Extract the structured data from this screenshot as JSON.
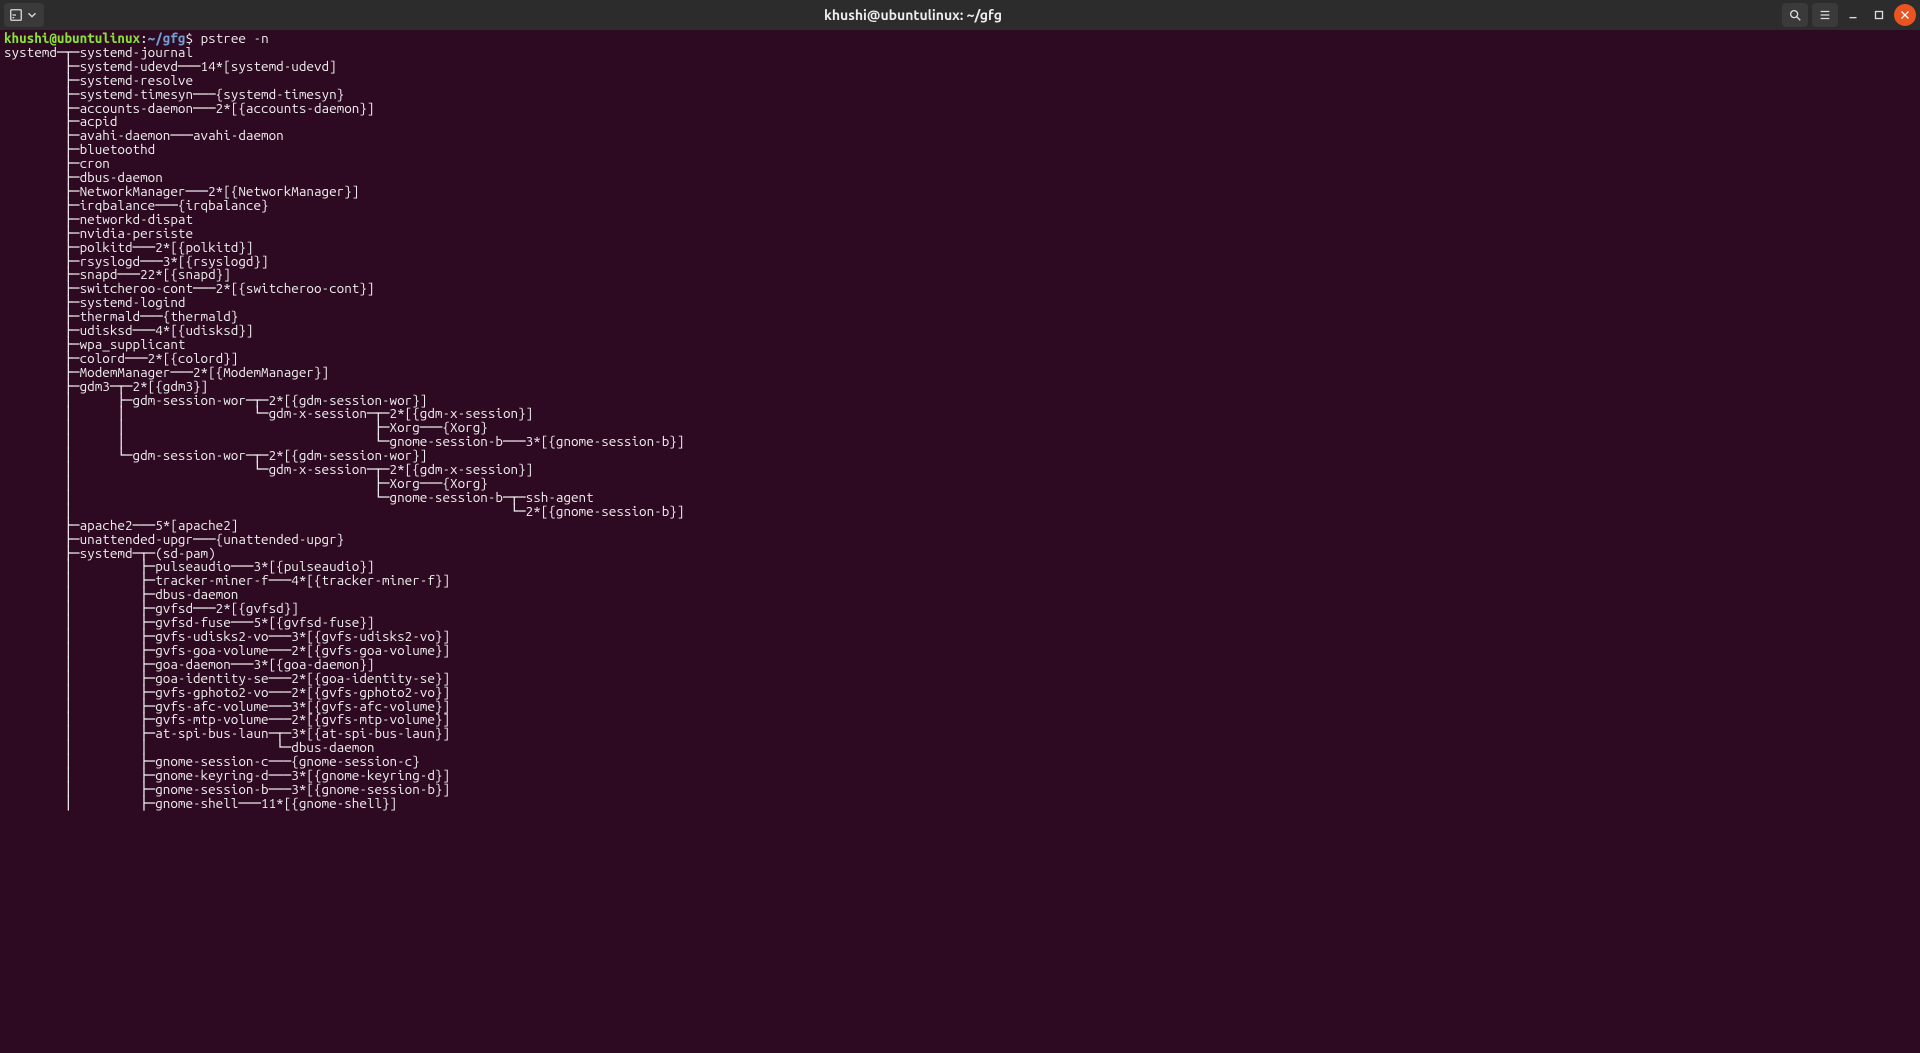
{
  "window": {
    "title": "khushi@ubuntulinux: ~/gfg"
  },
  "prompt": {
    "user_host": "khushi@ubuntulinux",
    "colon": ":",
    "path": "~/gfg",
    "symbol": "$",
    "command": "pstree -n"
  },
  "tree": "systemd─┬─systemd-journal\n        ├─systemd-udevd───14*[systemd-udevd]\n        ├─systemd-resolve\n        ├─systemd-timesyn───{systemd-timesyn}\n        ├─accounts-daemon───2*[{accounts-daemon}]\n        ├─acpid\n        ├─avahi-daemon───avahi-daemon\n        ├─bluetoothd\n        ├─cron\n        ├─dbus-daemon\n        ├─NetworkManager───2*[{NetworkManager}]\n        ├─irqbalance───{irqbalance}\n        ├─networkd-dispat\n        ├─nvidia-persiste\n        ├─polkitd───2*[{polkitd}]\n        ├─rsyslogd───3*[{rsyslogd}]\n        ├─snapd───22*[{snapd}]\n        ├─switcheroo-cont───2*[{switcheroo-cont}]\n        ├─systemd-logind\n        ├─thermald───{thermald}\n        ├─udisksd───4*[{udisksd}]\n        ├─wpa_supplicant\n        ├─colord───2*[{colord}]\n        ├─ModemManager───2*[{ModemManager}]\n        ├─gdm3─┬─2*[{gdm3}]\n        │      ├─gdm-session-wor─┬─2*[{gdm-session-wor}]\n        │      │                 └─gdm-x-session─┬─2*[{gdm-x-session}]\n        │      │                                 ├─Xorg───{Xorg}\n        │      │                                 └─gnome-session-b───3*[{gnome-session-b}]\n        │      └─gdm-session-wor─┬─2*[{gdm-session-wor}]\n        │                        └─gdm-x-session─┬─2*[{gdm-x-session}]\n        │                                        ├─Xorg───{Xorg}\n        │                                        └─gnome-session-b─┬─ssh-agent\n        │                                                          └─2*[{gnome-session-b}]\n        ├─apache2───5*[apache2]\n        ├─unattended-upgr───{unattended-upgr}\n        ├─systemd─┬─(sd-pam)\n        │         ├─pulseaudio───3*[{pulseaudio}]\n        │         ├─tracker-miner-f───4*[{tracker-miner-f}]\n        │         ├─dbus-daemon\n        │         ├─gvfsd───2*[{gvfsd}]\n        │         ├─gvfsd-fuse───5*[{gvfsd-fuse}]\n        │         ├─gvfs-udisks2-vo───3*[{gvfs-udisks2-vo}]\n        │         ├─gvfs-goa-volume───2*[{gvfs-goa-volume}]\n        │         ├─goa-daemon───3*[{goa-daemon}]\n        │         ├─goa-identity-se───2*[{goa-identity-se}]\n        │         ├─gvfs-gphoto2-vo───2*[{gvfs-gphoto2-vo}]\n        │         ├─gvfs-afc-volume───3*[{gvfs-afc-volume}]\n        │         ├─gvfs-mtp-volume───2*[{gvfs-mtp-volume}]\n        │         ├─at-spi-bus-laun─┬─3*[{at-spi-bus-laun}]\n        │         │                 └─dbus-daemon\n        │         ├─gnome-session-c───{gnome-session-c}\n        │         ├─gnome-keyring-d───3*[{gnome-keyring-d}]\n        │         ├─gnome-session-b───3*[{gnome-session-b}]\n        │         ├─gnome-shell───11*[{gnome-shell}]"
}
